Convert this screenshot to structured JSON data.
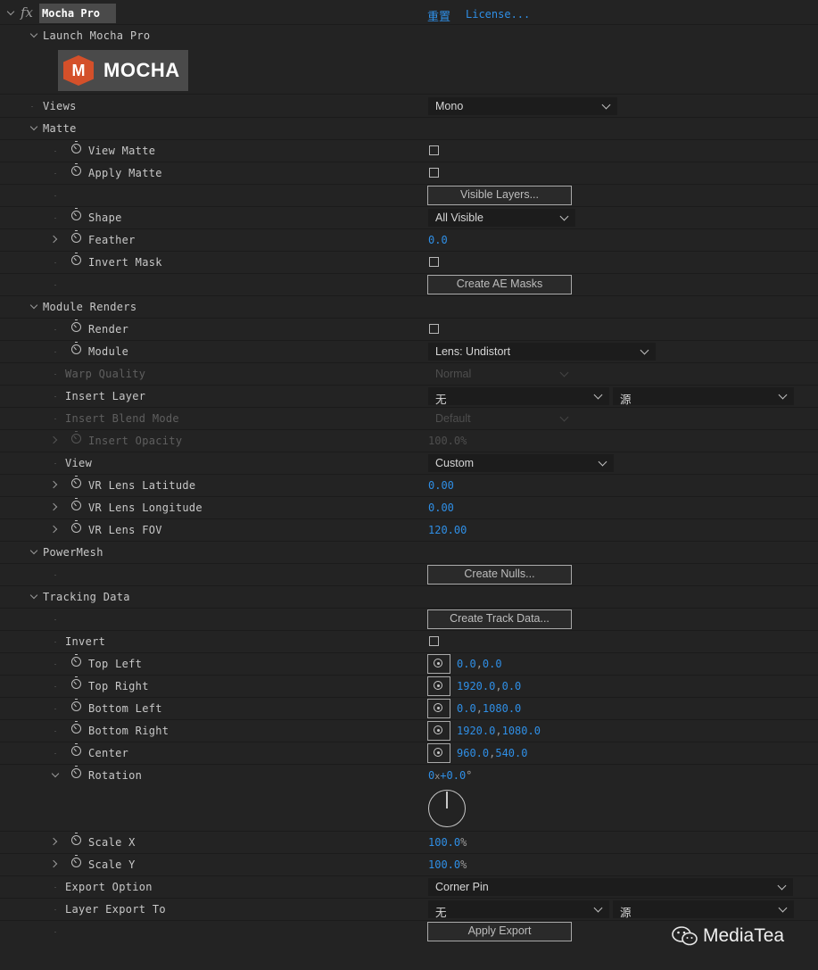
{
  "header": {
    "fx": "fx",
    "effect_name": "Mocha Pro",
    "reset": "重置",
    "license": "License..."
  },
  "launch": {
    "label": "Launch Mocha Pro",
    "logo_text": "MOCHA",
    "logo_letter": "M"
  },
  "views": {
    "label": "Views",
    "value": "Mono"
  },
  "matte": {
    "label": "Matte",
    "view_matte": "View Matte",
    "apply_matte": "Apply Matte",
    "visible_layers_btn": "Visible Layers...",
    "shape": {
      "label": "Shape",
      "value": "All Visible"
    },
    "feather": {
      "label": "Feather",
      "value": "0.0"
    },
    "invert_mask": "Invert Mask",
    "create_ae_masks_btn": "Create AE Masks"
  },
  "module_renders": {
    "label": "Module Renders",
    "render": "Render",
    "module": {
      "label": "Module",
      "value": "Lens: Undistort"
    },
    "warp_quality": {
      "label": "Warp Quality",
      "value": "Normal"
    },
    "insert_layer": {
      "label": "Insert Layer",
      "value1": "无",
      "value2": "源"
    },
    "insert_blend": {
      "label": "Insert Blend Mode",
      "value": "Default"
    },
    "insert_opacity": {
      "label": "Insert Opacity",
      "value": "100.0",
      "unit": "%"
    },
    "view": {
      "label": "View",
      "value": "Custom"
    },
    "vr_lat": {
      "label": "VR Lens Latitude",
      "value": "0.00"
    },
    "vr_long": {
      "label": "VR Lens Longitude",
      "value": "0.00"
    },
    "vr_fov": {
      "label": "VR Lens FOV",
      "value": "120.00"
    }
  },
  "powermesh": {
    "label": "PowerMesh",
    "create_nulls_btn": "Create Nulls..."
  },
  "tracking": {
    "label": "Tracking Data",
    "create_track_btn": "Create Track Data...",
    "invert": "Invert",
    "top_left": {
      "label": "Top Left",
      "x": "0.0",
      "y": "0.0"
    },
    "top_right": {
      "label": "Top Right",
      "x": "1920.0",
      "y": "0.0"
    },
    "bottom_left": {
      "label": "Bottom Left",
      "x": "0.0",
      "y": "1080.0"
    },
    "bottom_right": {
      "label": "Bottom Right",
      "x": "1920.0",
      "y": "1080.0"
    },
    "center": {
      "label": "Center",
      "x": "960.0",
      "y": "540.0"
    },
    "rotation": {
      "label": "Rotation",
      "turns": "0",
      "x": "x",
      "deg": "+0.0",
      "deg_sym": "°"
    },
    "scale_x": {
      "label": "Scale X",
      "value": "100.0",
      "unit": "%"
    },
    "scale_y": {
      "label": "Scale Y",
      "value": "100.0",
      "unit": "%"
    },
    "export_option": {
      "label": "Export Option",
      "value": "Corner Pin"
    },
    "layer_export": {
      "label": "Layer Export To",
      "value1": "无",
      "value2": "源"
    },
    "apply_export_btn": "Apply Export"
  },
  "watermark": {
    "text": "MediaTea"
  },
  "colors": {
    "value_blue": "#2f8fe6",
    "bg": "#232323",
    "logo_orange": "#d4502a"
  }
}
